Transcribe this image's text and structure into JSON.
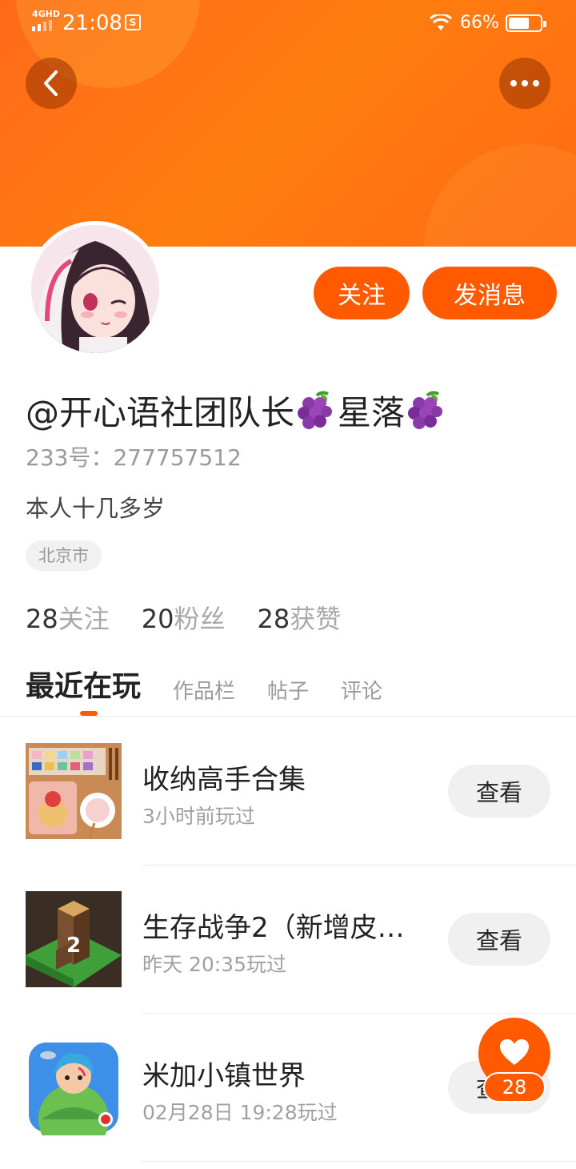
{
  "status_bar": {
    "network": "4GHD",
    "time": "21:08",
    "battery": "66%",
    "battery_level": 0.66
  },
  "header": {
    "back_icon": "back-arrow-icon",
    "more_icon": "more-dots-icon"
  },
  "profile": {
    "username_parts": [
      "@开心语社团队长",
      "星落"
    ],
    "id_line": "233号：277757512",
    "bio": "本人十几多岁",
    "location": "北京市",
    "follow_label": "关注",
    "message_label": "发消息"
  },
  "stats": [
    {
      "num": "28",
      "label": "关注"
    },
    {
      "num": "20",
      "label": "粉丝"
    },
    {
      "num": "28",
      "label": "获赞"
    }
  ],
  "tabs": [
    "最近在玩",
    "作品栏",
    "帖子",
    "评论"
  ],
  "games": [
    {
      "title": "收纳高手合集",
      "time": "3小时前玩过",
      "button": "查看"
    },
    {
      "title": "生存战争2（新增皮…",
      "time": "昨天 20:35玩过",
      "button": "查看"
    },
    {
      "title": "米加小镇世界",
      "time": "02月28日 19:28玩过",
      "button": "查看"
    }
  ],
  "fab": {
    "count": "28",
    "icon": "heart-icon"
  },
  "colors": {
    "accent": "#ff5a00",
    "banner": "#ff7a10"
  }
}
